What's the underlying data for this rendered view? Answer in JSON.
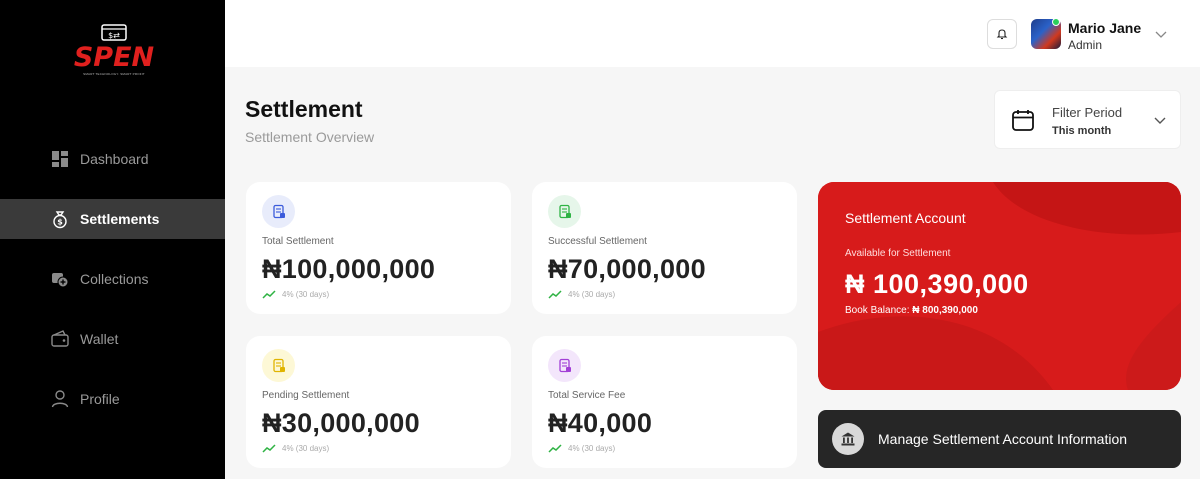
{
  "brand": {
    "name": "SPEN",
    "tagline": "SMART TECHNOLOGY. SMART PROFIT"
  },
  "sidebar": {
    "items": [
      {
        "label": "Dashboard",
        "icon": "dashboard-icon",
        "active": false
      },
      {
        "label": "Settlements",
        "icon": "money-bag-icon",
        "active": true
      },
      {
        "label": "Collections",
        "icon": "collections-icon",
        "active": false
      },
      {
        "label": "Wallet",
        "icon": "wallet-icon",
        "active": false
      },
      {
        "label": "Profile",
        "icon": "user-icon",
        "active": false
      }
    ]
  },
  "header": {
    "user_name": "Mario Jane",
    "user_role": "Admin"
  },
  "page": {
    "title": "Settlement",
    "subtitle": "Settlement Overview"
  },
  "filter": {
    "label": "Filter Period",
    "value": "This month"
  },
  "cards": [
    {
      "label": "Total Settlement",
      "value": "₦100,000,000",
      "trend": "4% (30 days)",
      "accent": "#3b5bdb"
    },
    {
      "label": "Successful Settlement",
      "value": "₦70,000,000",
      "trend": "4% (30 days)",
      "accent": "#2fb344"
    },
    {
      "label": "Pending Settlement",
      "value": "₦30,000,000",
      "trend": "4% (30 days)",
      "accent": "#e0b400"
    },
    {
      "label": "Total Service Fee",
      "value": "₦40,000",
      "trend": "4% (30 days)",
      "accent": "#a23fd6"
    }
  ],
  "account": {
    "title": "Settlement Account",
    "available_label": "Available for Settlement",
    "available_value": "₦ 100,390,000",
    "book_label": "Book Balance:",
    "book_value": "₦ 800,390,000"
  },
  "manage": {
    "label": "Manage Settlement Account Information"
  },
  "colors": {
    "brand_red": "#d71b1b",
    "sidebar_bg": "#000000",
    "trend_green": "#2fb344"
  }
}
